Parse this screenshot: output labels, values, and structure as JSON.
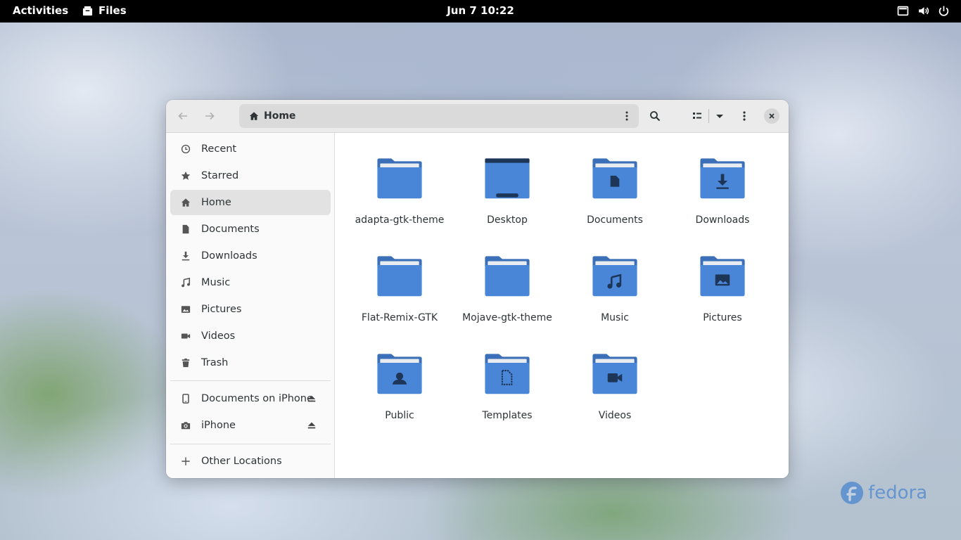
{
  "topbar": {
    "activities": "Activities",
    "app_name": "Files",
    "clock": "Jun 7  10:22"
  },
  "window": {
    "path": "Home"
  },
  "sidebar": {
    "items": [
      {
        "label": "Recent",
        "icon": "clock-icon"
      },
      {
        "label": "Starred",
        "icon": "star-icon"
      },
      {
        "label": "Home",
        "icon": "home-icon",
        "active": true
      },
      {
        "label": "Documents",
        "icon": "document-icon"
      },
      {
        "label": "Downloads",
        "icon": "download-icon"
      },
      {
        "label": "Music",
        "icon": "music-icon"
      },
      {
        "label": "Pictures",
        "icon": "picture-icon"
      },
      {
        "label": "Videos",
        "icon": "video-icon"
      },
      {
        "label": "Trash",
        "icon": "trash-icon"
      }
    ],
    "devices": [
      {
        "label": "Documents on iPhone",
        "icon": "phone-icon"
      },
      {
        "label": "iPhone",
        "icon": "camera-icon"
      }
    ],
    "other": "Other Locations"
  },
  "folders": [
    {
      "name": "adapta-gtk-theme",
      "emblem": "none"
    },
    {
      "name": "Desktop",
      "emblem": "desktop"
    },
    {
      "name": "Documents",
      "emblem": "document"
    },
    {
      "name": "Downloads",
      "emblem": "download"
    },
    {
      "name": "Flat-Remix-GTK",
      "emblem": "none"
    },
    {
      "name": "Mojave-gtk-theme",
      "emblem": "none"
    },
    {
      "name": "Music",
      "emblem": "music"
    },
    {
      "name": "Pictures",
      "emblem": "picture"
    },
    {
      "name": "Public",
      "emblem": "user"
    },
    {
      "name": "Templates",
      "emblem": "template"
    },
    {
      "name": "Videos",
      "emblem": "video"
    }
  ],
  "colors": {
    "folder_body": "#4a86d8",
    "folder_tab": "#3b6fb8",
    "folder_paper": "#e8ebf0",
    "emblem": "#1d3557",
    "accent_text": "#2e3436"
  },
  "watermark": "fedora"
}
